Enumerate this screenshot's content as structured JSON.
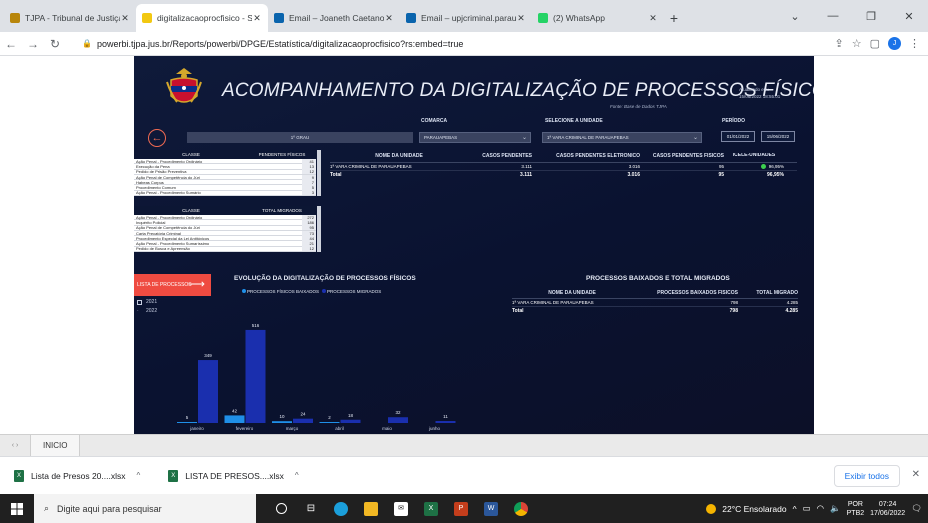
{
  "browser": {
    "tabs": [
      {
        "title": "TJPA - Tribunal de Justiça do",
        "icon": "tjpa-favicon",
        "active": false,
        "color": "#b8860b"
      },
      {
        "title": "digitalizacaoprocfisico - Serv",
        "icon": "powerbi-favicon",
        "active": true,
        "color": "#f2c811"
      },
      {
        "title": "Email – Joaneth Caetano de",
        "icon": "outlook-favicon",
        "active": false,
        "color": "#0a64ad"
      },
      {
        "title": "Email – upjcriminal.parauap",
        "icon": "outlook-favicon",
        "active": false,
        "color": "#0a64ad"
      },
      {
        "title": "(2) WhatsApp",
        "icon": "whatsapp-favicon",
        "active": false,
        "color": "#25d366"
      }
    ],
    "url": "powerbi.tjpa.jus.br/Reports/powerbi/DPGE/Estatística/digitalizacaoprocfisico?rs:embed=true",
    "profile_initial": "J"
  },
  "report": {
    "title": "ACOMPANHAMENTO DA DIGITALIZAÇÃO DE PROCESSOS FÍSICOS",
    "source": "Fonte: Base de Dados TJPA",
    "updated_label": "Atualizado em:",
    "updated_value": "15/06/2022 18:55:01",
    "filters": {
      "comarca_label": "COMARCA",
      "comarca_value": "PARAUAPEBAS",
      "unidade_label": "SELECIONE A UNIDADE",
      "unidade_value": "1ª VARA CRIMINAL DE PARAUAPEBAS",
      "periodo_label": "PERÍODO",
      "periodo_start": "01/01/2022",
      "periodo_end": "15/06/2022",
      "grau": "1º GRAU"
    },
    "classe_table": {
      "headers": [
        "CLASSE",
        "PENDENTES FÍSICOS"
      ],
      "rows": [
        [
          "Ação Penal - Procedimento Ordinário",
          "41"
        ],
        [
          "Execução da Pena",
          "13"
        ],
        [
          "Pedido de Prisão Preventiva",
          "12"
        ],
        [
          "Ação Penal de Competência do Júri",
          "9"
        ],
        [
          "Habeas Corpus",
          "7"
        ],
        [
          "Procedimento Comum",
          "5"
        ],
        [
          "Ação Penal - Procedimento Sumário",
          "3"
        ]
      ]
    },
    "migrados_table": {
      "headers": [
        "CLASSE",
        "TOTAL MIGRADOS"
      ],
      "rows": [
        [
          "Ação Penal - Procedimento Ordinário",
          "272"
        ],
        [
          "Inquérito Policial",
          "186"
        ],
        [
          "Ação Penal de Competência do Júri",
          "95"
        ],
        [
          "Carta Precatória Criminal",
          "73"
        ],
        [
          "Procedimento Especial da Lei Antitóxicos",
          "44"
        ],
        [
          "Ação Penal - Procedimento Sumaríssimo",
          "21"
        ],
        [
          "Pedido de Busca e Apreensão",
          "12"
        ]
      ]
    },
    "unit_table": {
      "headers": [
        "NOME DA UNIDADE",
        "CASOS PENDENTES",
        "CASOS PENDENTES ELETRONICO",
        "CASOS PENDENTES FÍSICOS",
        "ICELE-UNIDADES"
      ],
      "rows": [
        {
          "nome": "1ª VARA CRIMINAL DE PARAUAPEBAS",
          "pendentes": "3.111",
          "eletronico": "3.016",
          "fisicos": "95",
          "icele": "96,95%"
        }
      ],
      "total": {
        "nome": "Total",
        "pendentes": "3.111",
        "eletronico": "3.016",
        "fisicos": "95",
        "icele": "96,95%"
      }
    },
    "lista_button": "LISTA DE PROCESSOS",
    "years": [
      "2021",
      "2022"
    ],
    "chart_title": "EVOLUÇÃO DA DIGITALIZAÇÃO DE PROCESSOS FÍSICOS",
    "baixados_title": "PROCESSOS BAIXADOS E TOTAL MIGRADOS",
    "baixados_table": {
      "headers": [
        "NOME DA UNIDADE",
        "PROCESSOS BAIXADOS FÍSICOS",
        "TOTAL MIGRADO"
      ],
      "rows": [
        {
          "nome": "1ª VARA CRIMINAL DE PARAUAPEBAS",
          "baixados": "798",
          "migrado": "4.285"
        }
      ],
      "total": {
        "nome": "Total",
        "baixados": "798",
        "migrado": "4.285"
      }
    },
    "page_tab": "INICIO"
  },
  "chart_data": {
    "type": "bar",
    "title": "EVOLUÇÃO DA DIGITALIZAÇÃO DE PROCESSOS FÍSICOS",
    "categories": [
      "janeiro",
      "fevereiro",
      "março",
      "abril",
      "maio",
      "junho"
    ],
    "series": [
      {
        "name": "PROCESSOS FÍSICOS BAIXADOS",
        "color": "#1f8fe8",
        "values": [
          5,
          42,
          10,
          2,
          0,
          0
        ]
      },
      {
        "name": "PROCESSOS MIGRADOS",
        "color": "#1a2fae",
        "values": [
          349,
          516,
          24,
          18,
          32,
          11
        ]
      }
    ],
    "ylim": [
      0,
      560
    ]
  },
  "downloads": {
    "items": [
      "Lista de Presos 20....xlsx",
      "LISTA DE PRESOS....xlsx"
    ],
    "show_all": "Exibir todos"
  },
  "taskbar": {
    "search_placeholder": "Digite aqui para pesquisar",
    "weather": "22°C  Ensolarado",
    "lang_top": "POR",
    "lang_bottom": "PTB2",
    "time": "07:24",
    "date": "17/06/2022"
  }
}
